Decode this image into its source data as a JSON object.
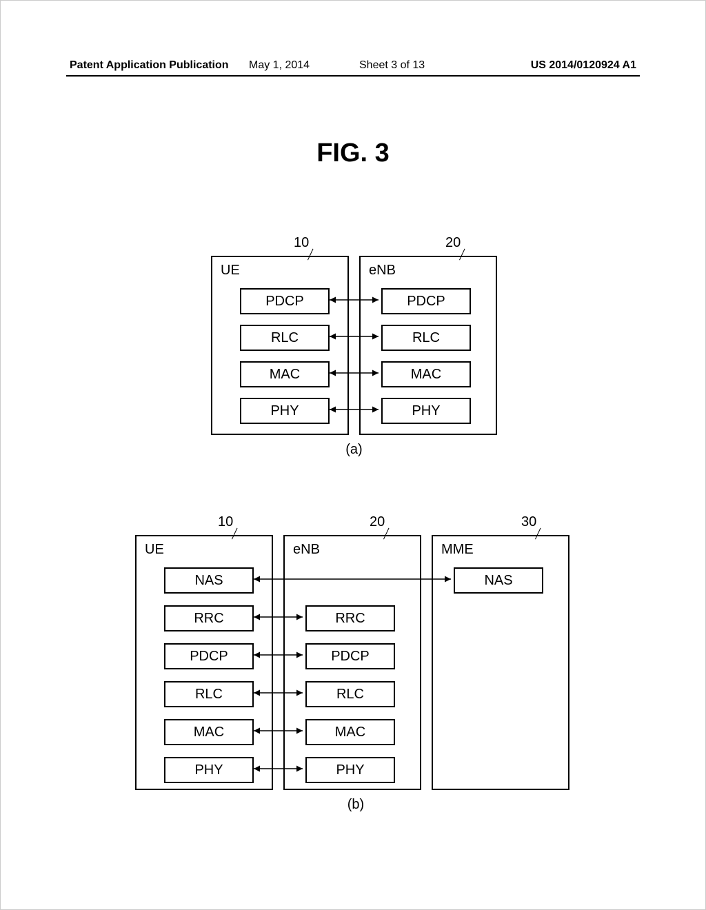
{
  "header": {
    "pub": "Patent Application Publication",
    "date": "May 1, 2014",
    "sheet": "Sheet 3 of 13",
    "num": "US 2014/0120924 A1"
  },
  "fig_title": "FIG. 3",
  "diagram_a": {
    "ue_ref": "10",
    "enb_ref": "20",
    "ue_label": "UE",
    "enb_label": "eNB",
    "layers": [
      "PDCP",
      "RLC",
      "MAC",
      "PHY"
    ],
    "sub": "(a)"
  },
  "diagram_b": {
    "ue_ref": "10",
    "enb_ref": "20",
    "mme_ref": "30",
    "ue_label": "UE",
    "enb_label": "eNB",
    "mme_label": "MME",
    "ue_layers": [
      "NAS",
      "RRC",
      "PDCP",
      "RLC",
      "MAC",
      "PHY"
    ],
    "enb_layers": [
      "RRC",
      "PDCP",
      "RLC",
      "MAC",
      "PHY"
    ],
    "mme_layers": [
      "NAS"
    ],
    "sub": "(b)"
  }
}
